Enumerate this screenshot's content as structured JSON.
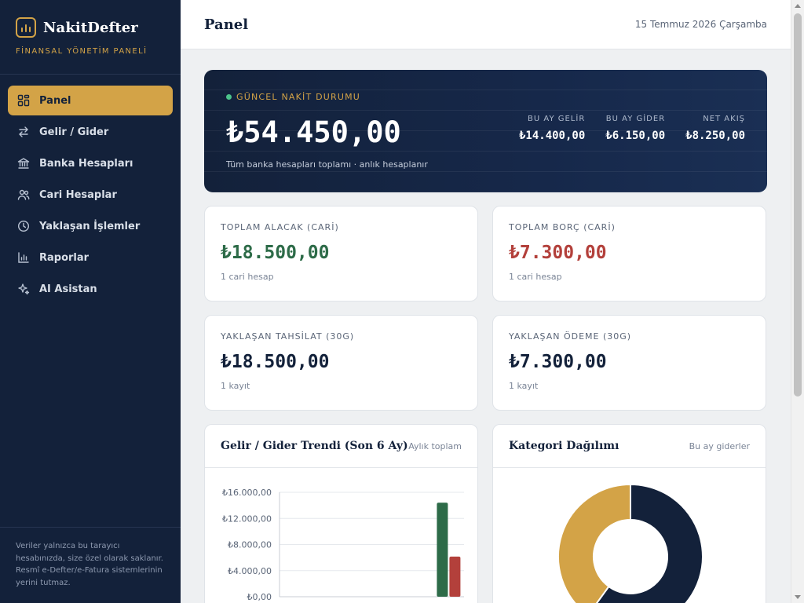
{
  "brand": {
    "name": "NakitDefter",
    "subtitle": "FİNANSAL YÖNETİM PANELİ"
  },
  "nav": [
    {
      "label": "Panel",
      "icon": "dashboard-icon",
      "active": true
    },
    {
      "label": "Gelir / Gider",
      "icon": "transfer-arrows-icon",
      "active": false
    },
    {
      "label": "Banka Hesapları",
      "icon": "bank-icon",
      "active": false
    },
    {
      "label": "Cari Hesaplar",
      "icon": "users-icon",
      "active": false
    },
    {
      "label": "Yaklaşan İşlemler",
      "icon": "clock-icon",
      "active": false
    },
    {
      "label": "Raporlar",
      "icon": "bar-chart-icon",
      "active": false
    },
    {
      "label": "AI Asistan",
      "icon": "sparkle-icon",
      "active": false
    }
  ],
  "footer_note": "Veriler yalnızca bu tarayıcı hesabınızda, size özel olarak saklanır. Resmî e-Defter/e-Fatura sistemlerinin yerini tutmaz.",
  "header": {
    "title": "Panel",
    "date": "15 Temmuz 2026 Çarşamba"
  },
  "hero": {
    "label": "GÜNCEL NAKİT DURUMU",
    "amount": "₺54.450,00",
    "note": "Tüm banka hesapları toplamı · anlık hesaplanır",
    "stats": [
      {
        "label": "BU AY GELİR",
        "value": "₺14.400,00"
      },
      {
        "label": "BU AY GİDER",
        "value": "₺6.150,00"
      },
      {
        "label": "NET AKIŞ",
        "value": "₺8.250,00"
      }
    ]
  },
  "kpis": {
    "receivable": {
      "label": "TOPLAM ALACAK (CARİ)",
      "value": "₺18.500,00",
      "sub": "1 cari hesap"
    },
    "payable": {
      "label": "TOPLAM BORÇ (CARİ)",
      "value": "₺7.300,00",
      "sub": "1 cari hesap"
    },
    "upcoming_collection": {
      "label": "YAKLAŞAN TAHSİLAT (30G)",
      "value": "₺18.500,00",
      "sub": "1 kayıt"
    },
    "upcoming_payment": {
      "label": "YAKLAŞAN ÖDEME (30G)",
      "value": "₺7.300,00",
      "sub": "1 kayıt"
    }
  },
  "trend_panel": {
    "title": "Gelir / Gider Trendi (Son 6 Ay)",
    "note": "Aylık toplam"
  },
  "category_panel": {
    "title": "Kategori Dağılımı",
    "note": "Bu ay giderler"
  },
  "colors": {
    "navy": "#13213a",
    "gold": "#d3a347",
    "income": "#2d6b48",
    "expense": "#b3403b",
    "positive_dot": "#4cc38a"
  },
  "chart_data": [
    {
      "type": "bar",
      "ylim": [
        0,
        16000
      ],
      "yticks": [
        "₺0,00",
        "₺4.000,00",
        "₺8.000,00",
        "₺12.000,00",
        "₺16.000,00"
      ],
      "ytick_values": [
        0,
        4000,
        8000,
        12000,
        16000
      ],
      "series": [
        {
          "values": [
            0,
            0,
            0,
            0,
            0,
            14400
          ],
          "color": "#2d6b48"
        },
        {
          "values": [
            0,
            0,
            0,
            0,
            0,
            6150
          ],
          "color": "#b3403b"
        }
      ],
      "grid": true
    },
    {
      "type": "pie",
      "donut": true,
      "values": [
        60,
        40
      ],
      "colors": [
        "#13213a",
        "#d3a347"
      ]
    }
  ]
}
